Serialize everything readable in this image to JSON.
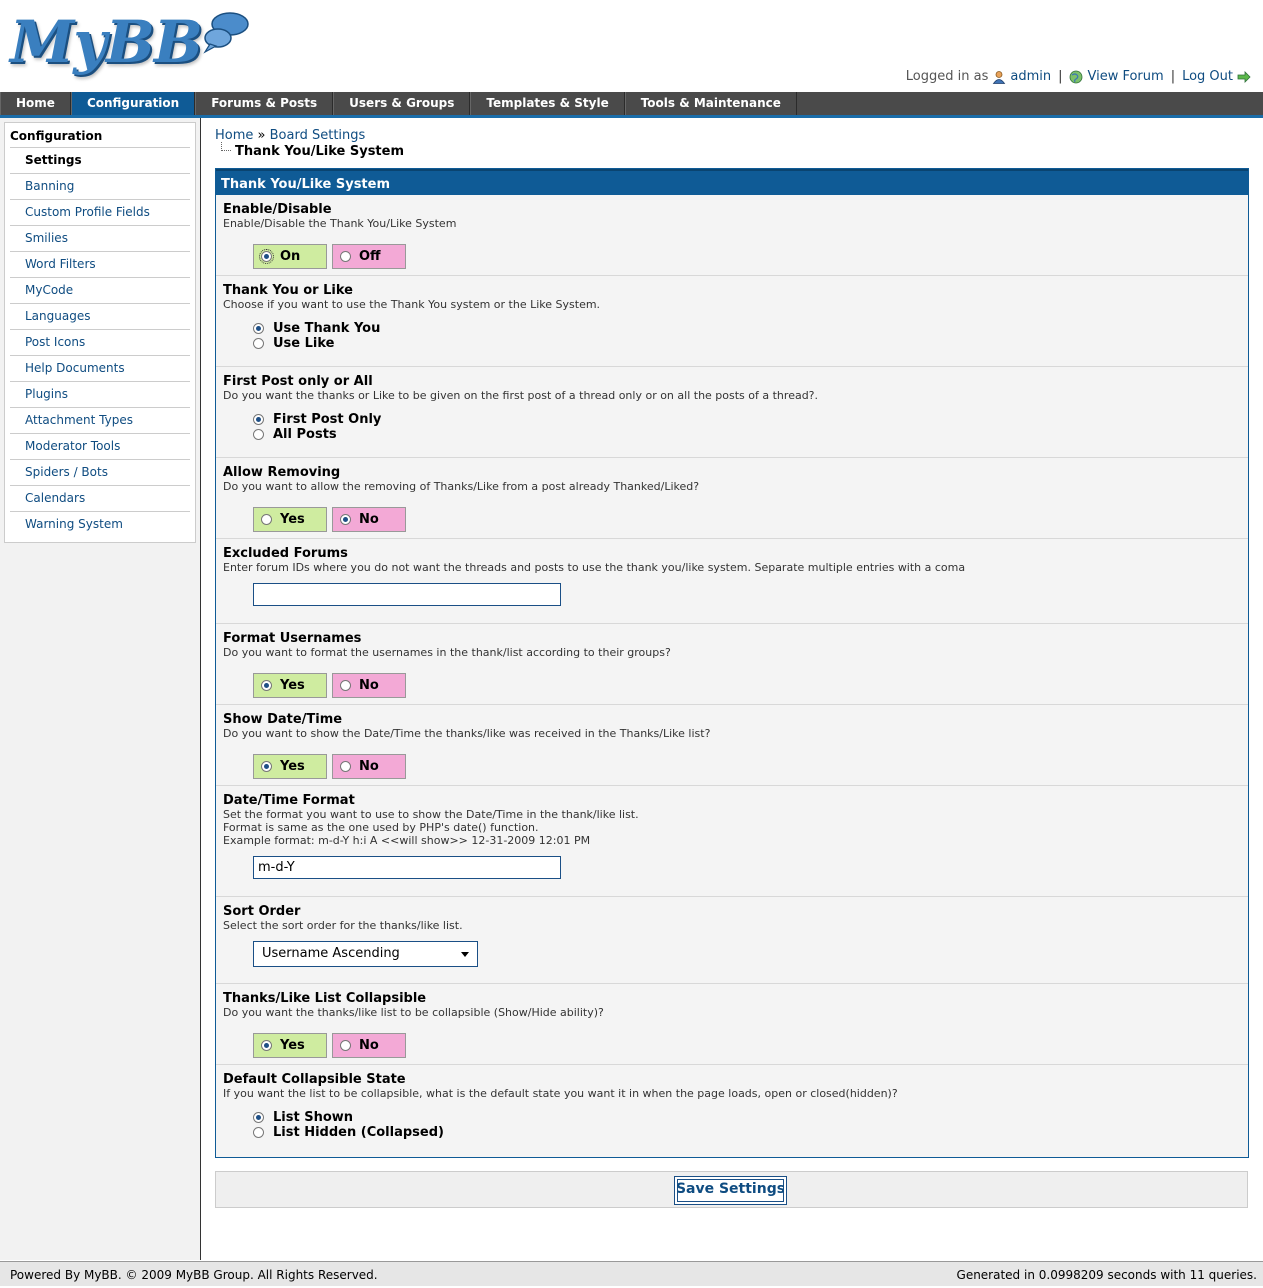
{
  "header": {
    "logo_text": "MyBB",
    "logged_in_as": "Logged in as",
    "username": "admin",
    "view_forum": "View Forum",
    "log_out": "Log Out",
    "separator": "|"
  },
  "nav": {
    "tabs": [
      {
        "label": "Home",
        "active": false
      },
      {
        "label": "Configuration",
        "active": true
      },
      {
        "label": "Forums & Posts",
        "active": false
      },
      {
        "label": "Users & Groups",
        "active": false
      },
      {
        "label": "Templates & Style",
        "active": false
      },
      {
        "label": "Tools & Maintenance",
        "active": false
      }
    ]
  },
  "sidebar": {
    "title": "Configuration",
    "items": [
      {
        "label": "Settings",
        "active": true
      },
      {
        "label": "Banning"
      },
      {
        "label": "Custom Profile Fields"
      },
      {
        "label": "Smilies"
      },
      {
        "label": "Word Filters"
      },
      {
        "label": "MyCode"
      },
      {
        "label": "Languages"
      },
      {
        "label": "Post Icons"
      },
      {
        "label": "Help Documents"
      },
      {
        "label": "Plugins"
      },
      {
        "label": "Attachment Types"
      },
      {
        "label": "Moderator Tools"
      },
      {
        "label": "Spiders / Bots"
      },
      {
        "label": "Calendars"
      },
      {
        "label": "Warning System"
      }
    ]
  },
  "breadcrumb": {
    "home": "Home",
    "separator": "»",
    "board_settings": "Board Settings",
    "current": "Thank You/Like System"
  },
  "panel": {
    "title": "Thank You/Like System",
    "settings": {
      "enable": {
        "title": "Enable/Disable",
        "desc": "Enable/Disable the Thank You/Like System",
        "yes_label": "On",
        "no_label": "Off",
        "value": "On"
      },
      "mode": {
        "title": "Thank You or Like",
        "desc": "Choose if you want to use the Thank You system or the Like System.",
        "options": [
          "Use Thank You",
          "Use Like"
        ],
        "selected": "Use Thank You"
      },
      "scope": {
        "title": "First Post only or All",
        "desc": "Do you want the thanks or Like to be given on the first post of a thread only or on all the posts of a thread?.",
        "options": [
          "First Post Only",
          "All Posts"
        ],
        "selected": "First Post Only"
      },
      "allow_removing": {
        "title": "Allow Removing",
        "desc": "Do you want to allow the removing of Thanks/Like from a post already Thanked/Liked?",
        "yes_label": "Yes",
        "no_label": "No",
        "value": "No"
      },
      "excluded_forums": {
        "title": "Excluded Forums",
        "desc": "Enter forum IDs where you do not want the threads and posts to use the thank you/like system. Separate multiple entries with a coma",
        "value": ""
      },
      "format_usernames": {
        "title": "Format Usernames",
        "desc": "Do you want to format the usernames in the thank/list according to their groups?",
        "yes_label": "Yes",
        "no_label": "No",
        "value": "Yes"
      },
      "show_datetime": {
        "title": "Show Date/Time",
        "desc": "Do you want to show the Date/Time the thanks/like was received in the Thanks/Like list?",
        "yes_label": "Yes",
        "no_label": "No",
        "value": "Yes"
      },
      "datetime_format": {
        "title": "Date/Time Format",
        "desc_line1": "Set the format you want to use to show the Date/Time in the thank/like list.",
        "desc_line2": "Format is same as the one used by PHP's date() function.",
        "desc_line3": "Example format: m-d-Y h:i A <<will show>> 12-31-2009 12:01 PM",
        "value": "m-d-Y"
      },
      "sort_order": {
        "title": "Sort Order",
        "desc": "Select the sort order for the thanks/like list.",
        "value": "Username Ascending"
      },
      "collapsible": {
        "title": "Thanks/Like List Collapsible",
        "desc": "Do you want the thanks/like list to be collapsible (Show/Hide ability)?",
        "yes_label": "Yes",
        "no_label": "No",
        "value": "Yes"
      },
      "default_collapse": {
        "title": "Default Collapsible State",
        "desc": "If you want the list to be collapsible, what is the default state you want it in when the page loads, open or closed(hidden)?",
        "options": [
          "List Shown",
          "List Hidden (Collapsed)"
        ],
        "selected": "List Shown"
      }
    },
    "save_label": "Save Settings"
  },
  "footer": {
    "left": "Powered By MyBB. © 2009 MyBB Group. All Rights Reserved.",
    "right": "Generated in 0.0998209 seconds with 11 queries."
  },
  "colors": {
    "brand_blue": "#0f5b96",
    "yes_bg": "#cfeca0",
    "no_bg": "#f3a9d6",
    "nav_bg": "#4a4a4a"
  }
}
